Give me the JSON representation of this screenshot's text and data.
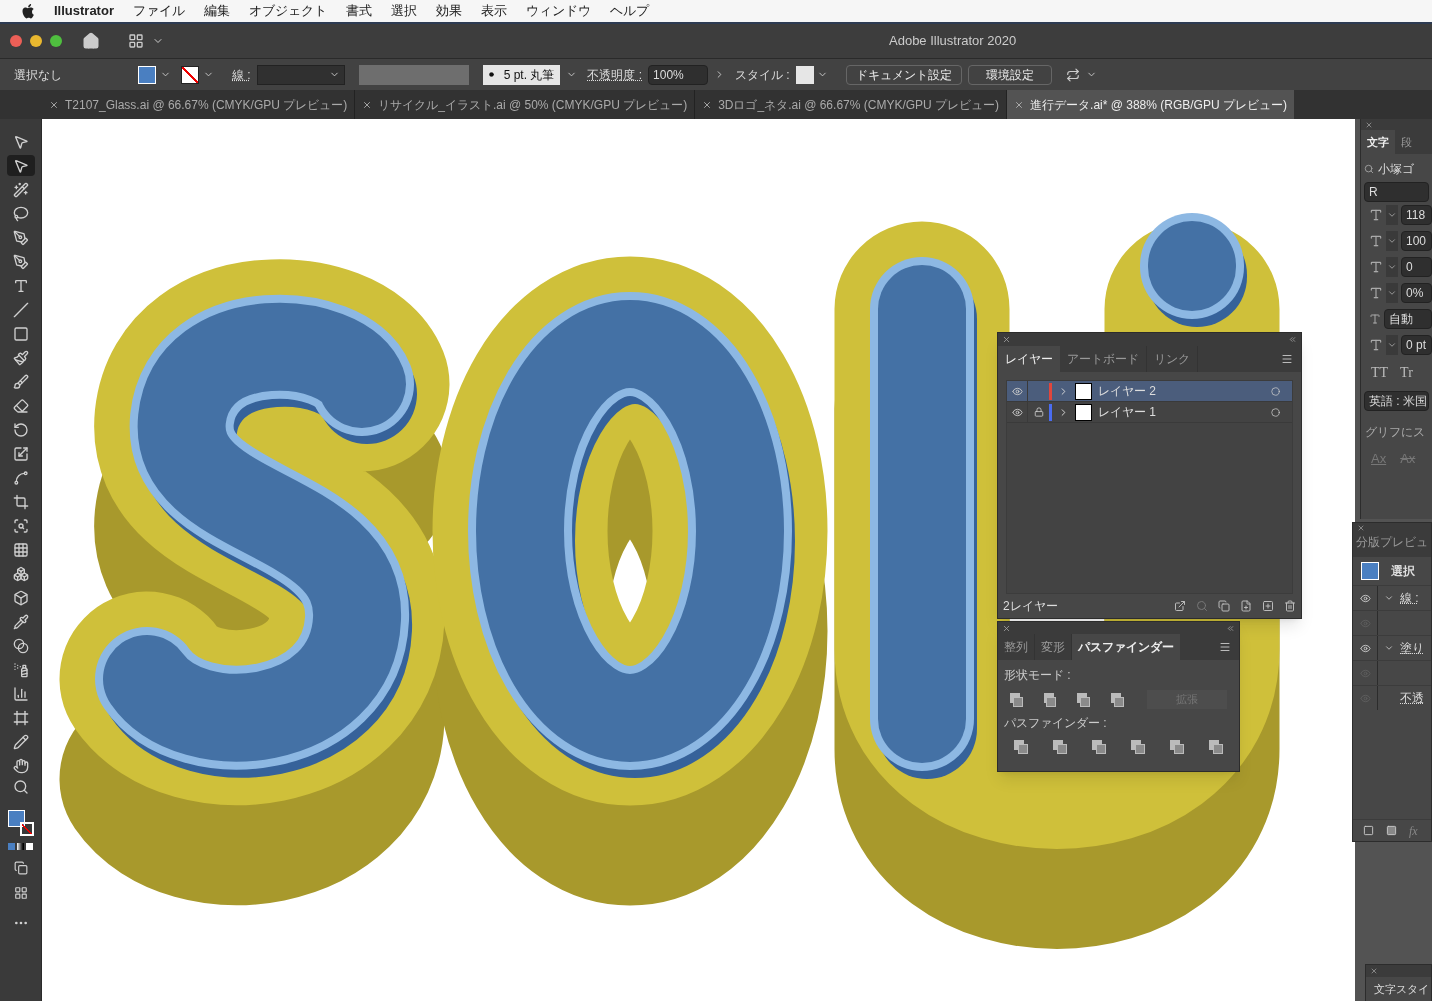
{
  "menu_bar": {
    "app": "Illustrator",
    "items": [
      "ファイル",
      "編集",
      "オブジェクト",
      "書式",
      "選択",
      "効果",
      "表示",
      "ウィンドウ",
      "ヘルプ"
    ]
  },
  "window": {
    "title": "Adobe Illustrator 2020"
  },
  "control_bar": {
    "selection": "選択なし",
    "stroke_label": "線 :",
    "brush": "5 pt. 丸筆",
    "opacity_label": "不透明度 :",
    "opacity": "100%",
    "style_label": "スタイル :",
    "buttons": [
      "ドキュメント設定",
      "環境設定"
    ]
  },
  "doc_tabs": [
    {
      "label": "T2107_Glass.ai @ 66.67% (CMYK/GPU プレビュー)",
      "selected": false
    },
    {
      "label": "リサイクル_イラスト.ai @ 50% (CMYK/GPU プレビュー)",
      "selected": false
    },
    {
      "label": "3Dロゴ_ネタ.ai @ 66.67% (CMYK/GPU プレビュー)",
      "selected": false
    },
    {
      "label": "進行データ.ai* @ 388% (RGB/GPU プレビュー)",
      "selected": true
    }
  ],
  "tools": [
    {
      "selected": false
    },
    {
      "selected": true
    },
    {
      "selected": false
    },
    {
      "selected": false
    },
    {
      "selected": false
    },
    {
      "selected": false
    },
    {
      "selected": false
    },
    {
      "selected": false
    },
    {
      "selected": false
    },
    {
      "selected": false
    },
    {
      "selected": false
    },
    {
      "selected": false
    },
    {
      "selected": false
    },
    {
      "selected": false
    },
    {
      "selected": false
    },
    {
      "selected": false
    },
    {
      "selected": false
    },
    {
      "selected": false
    },
    {
      "selected": false
    },
    {
      "selected": false
    },
    {
      "selected": false
    },
    {
      "selected": false
    },
    {
      "selected": false
    },
    {
      "selected": false
    },
    {
      "selected": false
    },
    {
      "selected": false
    },
    {
      "selected": false
    }
  ],
  "character_panel": {
    "tabs": [
      {
        "label": "文字",
        "selected": true
      },
      {
        "label": "段",
        "selected": false
      }
    ],
    "font": "小塚ゴ",
    "style": "R",
    "size": "118",
    "leading": "100",
    "tracking": "0",
    "tsume": "0%",
    "aki": "自動",
    "baseline": "0 pt",
    "caps": [
      "TT",
      "Tr"
    ],
    "language": "英語 : 米国",
    "glyph_label": "グリフにス",
    "ax": [
      "Ax",
      "Ax"
    ]
  },
  "fx_label": "fx",
  "appearance_panel": {
    "title": "分版プレビュ",
    "selection": "選択",
    "rows": [
      {
        "kind": "header",
        "label": "線 :",
        "visible": true
      },
      {
        "kind": "blank",
        "visible": false
      },
      {
        "kind": "header",
        "label": "塗り",
        "visible": true
      },
      {
        "kind": "blank",
        "visible": false
      },
      {
        "kind": "plain",
        "label": "不透",
        "visible": false
      }
    ]
  },
  "layers_panel": {
    "tabs": [
      {
        "label": "レイヤー",
        "selected": true
      },
      {
        "label": "アートボード",
        "selected": false
      },
      {
        "label": "リンク",
        "selected": false
      }
    ],
    "layers": [
      {
        "name": "レイヤー 2",
        "color": "#e0463c",
        "selected": true,
        "locked": false
      },
      {
        "name": "レイヤー 1",
        "color": "#4a6cf0",
        "selected": false,
        "locked": true
      }
    ],
    "footer": "2レイヤー"
  },
  "pathfinder_panel": {
    "tabs": [
      {
        "label": "整列",
        "selected": false
      },
      {
        "label": "変形",
        "selected": false
      },
      {
        "label": "パスファインダー",
        "selected": true
      }
    ],
    "shape_modes_label": "形状モード :",
    "expand": {
      "label": "拡張",
      "disabled": true
    },
    "pathfinders_label": "パスファインダー :"
  },
  "char_style_panel": {
    "title": "文字スタイ"
  }
}
